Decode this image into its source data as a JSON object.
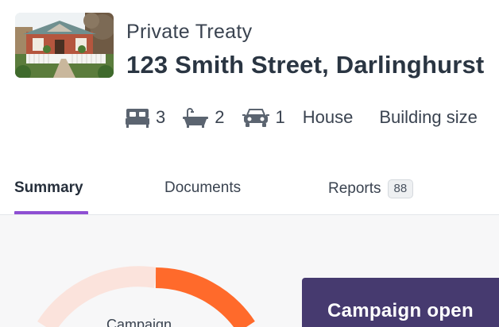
{
  "listing": {
    "sale_type": "Private Treaty",
    "address": "123 Smith Street, Darlinghurst",
    "thumbnail_icon": "house-photo"
  },
  "features": {
    "bedrooms": "3",
    "bathrooms": "2",
    "car_spaces": "1",
    "property_type": "House",
    "building_size_label": "Building size"
  },
  "tabs": {
    "summary": "Summary",
    "documents": "Documents",
    "reports": "Reports",
    "reports_count": "88",
    "active": "Summary"
  },
  "summary": {
    "ring_label": "Campaign",
    "campaign_status": "Campaign open"
  },
  "colors": {
    "accent_tab": "#8e4fd3",
    "ring_progress": "#ff6a2b",
    "ring_track": "#fbe3dc",
    "campaign_card": "#463a6f",
    "text_dark": "#2a3542"
  }
}
